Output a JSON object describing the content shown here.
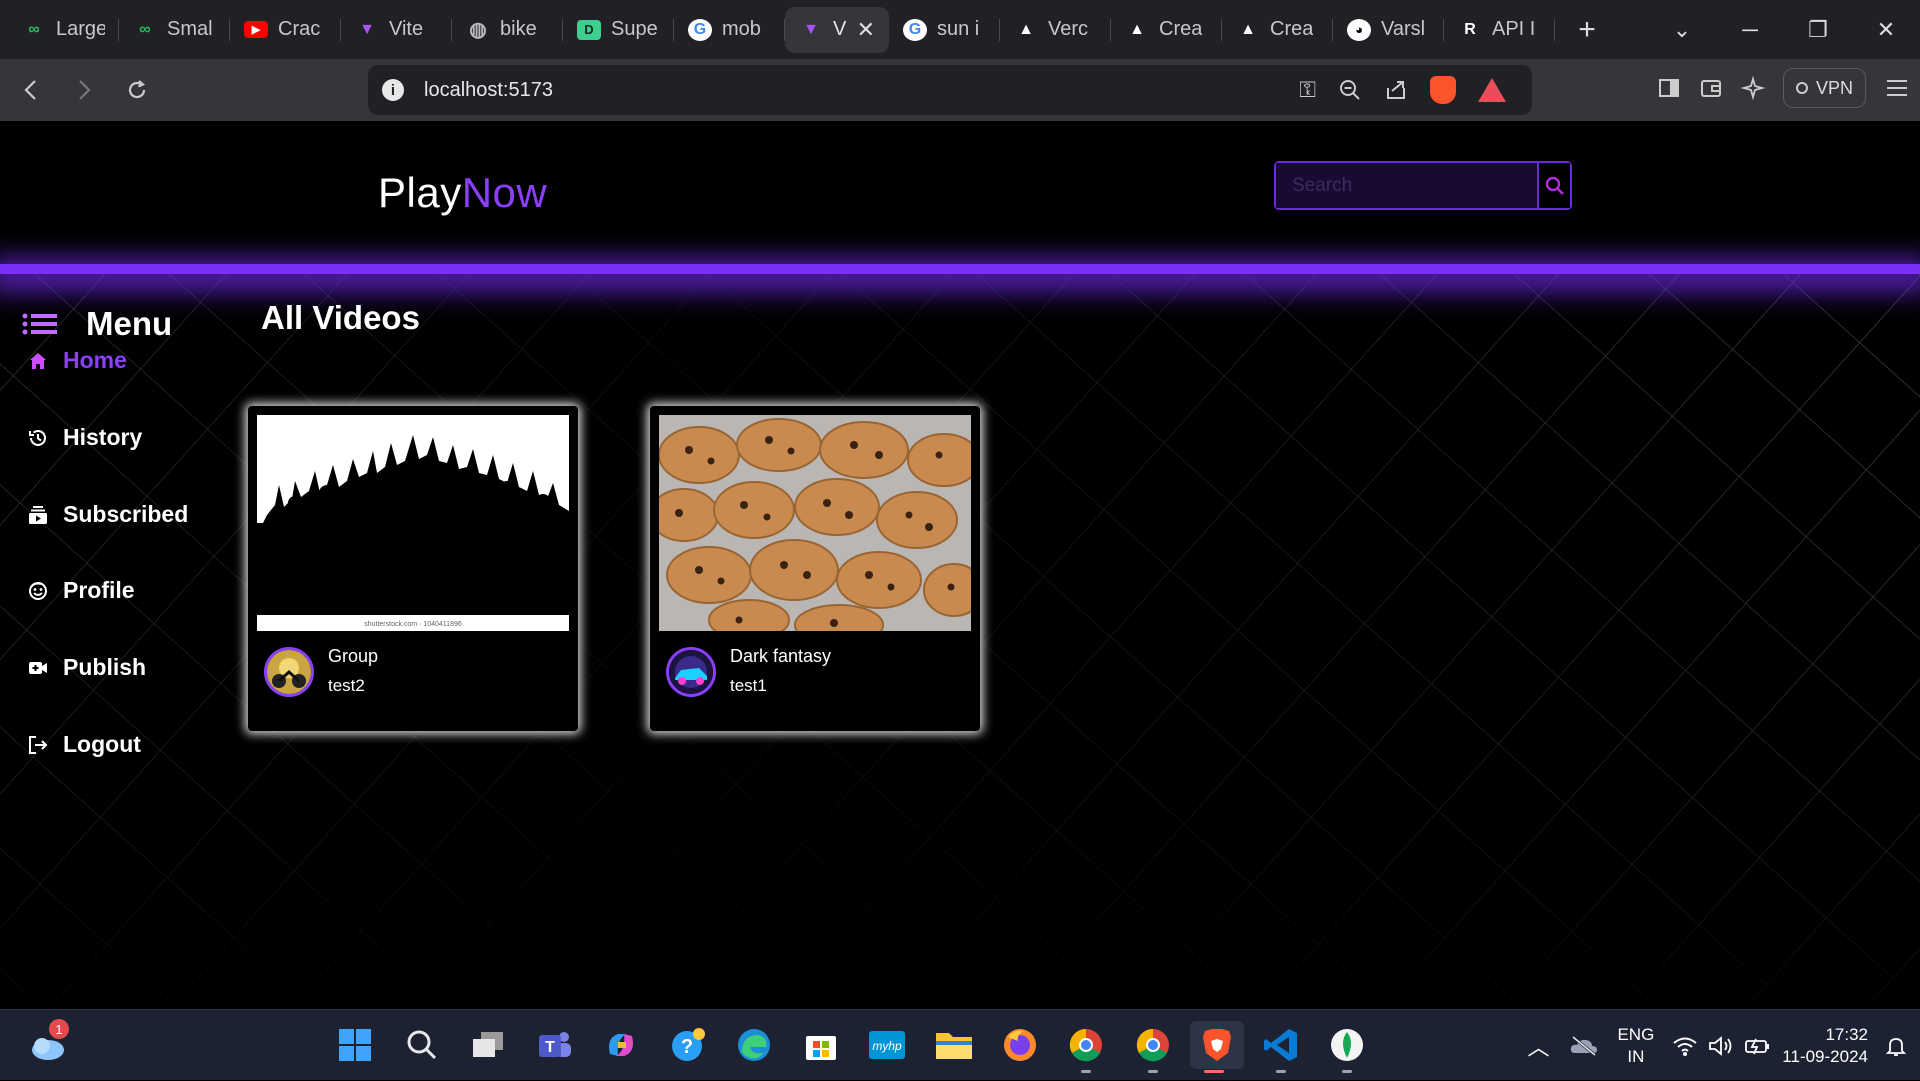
{
  "browser": {
    "tabs": [
      {
        "title": "Large",
        "icon": "leetcode-icon"
      },
      {
        "title": "Smal",
        "icon": "leetcode-icon"
      },
      {
        "title": "Crac",
        "icon": "youtube-icon"
      },
      {
        "title": "Vite",
        "icon": "vite-icon"
      },
      {
        "title": "bike",
        "icon": "globe-icon"
      },
      {
        "title": "Supe",
        "icon": "supabase-icon"
      },
      {
        "title": "mob",
        "icon": "google-icon"
      },
      {
        "title": "V",
        "icon": "vite-icon",
        "active": true
      },
      {
        "title": "sun i",
        "icon": "google-icon"
      },
      {
        "title": "Verc",
        "icon": "vercel-icon"
      },
      {
        "title": "Crea",
        "icon": "vercel-icon"
      },
      {
        "title": "Crea",
        "icon": "vercel-icon"
      },
      {
        "title": "Varsl",
        "icon": "github-icon"
      },
      {
        "title": "API I",
        "icon": "render-icon"
      }
    ],
    "new_tab": "+",
    "url": "localhost:5173",
    "vpn_label": "VPN"
  },
  "app": {
    "logo_part1": "Play",
    "logo_part2": "Now",
    "search_placeholder": "Search",
    "section_title": "All Videos",
    "menu_label": "Menu",
    "nav": [
      {
        "label": "Home",
        "icon": "home-icon",
        "active": true
      },
      {
        "label": "History",
        "icon": "history-icon"
      },
      {
        "label": "Subscribed",
        "icon": "subscriptions-icon"
      },
      {
        "label": "Profile",
        "icon": "profile-icon"
      },
      {
        "label": "Publish",
        "icon": "video-add-icon"
      },
      {
        "label": "Logout",
        "icon": "logout-icon"
      }
    ],
    "videos": [
      {
        "title": "Group",
        "channel": "test2",
        "thumbnail": "crowd-silhouette",
        "watermark": "shutterstock.com · 1040411896"
      },
      {
        "title": "Dark fantasy",
        "channel": "test1",
        "thumbnail": "chocolate-chip-cookies"
      }
    ],
    "accent_color": "#8a3ffc"
  },
  "taskbar": {
    "weather_badge": "1",
    "apps": [
      "windows-start-icon",
      "search-icon",
      "task-view-icon",
      "teams-icon",
      "copilot-icon",
      "help-icon",
      "edge-icon",
      "store-icon",
      "myhp-icon",
      "file-explorer-icon",
      "firefox-icon",
      "chrome-icon",
      "chrome-icon",
      "brave-icon",
      "vscode-icon",
      "mongodb-icon"
    ],
    "lang_line1": "ENG",
    "lang_line2": "IN",
    "time": "17:32",
    "date": "11-09-2024"
  }
}
